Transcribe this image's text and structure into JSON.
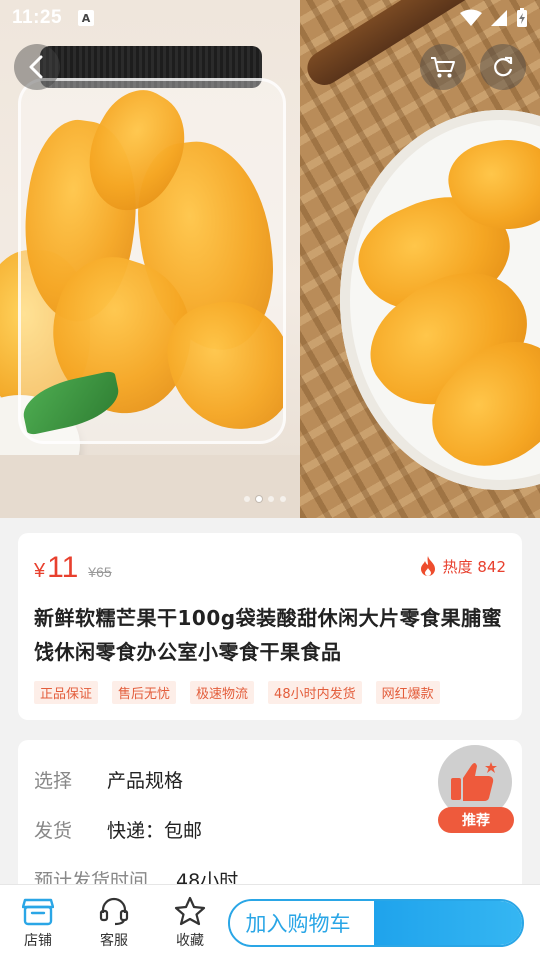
{
  "status_bar": {
    "time": "11:25"
  },
  "hero": {
    "carousel": {
      "count": 4,
      "active_index": 1
    }
  },
  "product": {
    "currency": "¥",
    "price": "11",
    "original_price": "¥65",
    "heat_label": "热度 842",
    "title": "新鲜软糯芒果干100g袋装酸甜休闲大片零食果脯蜜饯休闲零食办公室小零食干果食品",
    "tags": [
      "正品保证",
      "售后无忧",
      "极速物流",
      "48小时内发货",
      "网红爆款"
    ]
  },
  "spec": {
    "rows": [
      {
        "key": "选择",
        "value": "产品规格"
      },
      {
        "key": "发货",
        "value": "快递：包邮"
      },
      {
        "key": "预计发货时间",
        "value": "48小时"
      }
    ]
  },
  "recommend": {
    "label": "推荐"
  },
  "bottom_bar": {
    "items": [
      {
        "label": "店铺",
        "icon": "store-icon"
      },
      {
        "label": "客服",
        "icon": "headset-icon"
      },
      {
        "label": "收藏",
        "icon": "star-icon"
      }
    ],
    "add_to_cart": "加入购物车"
  },
  "colors": {
    "accent": "#2aa6e6",
    "price": "#e8402e",
    "tag_bg": "#fdeee8",
    "recommend": "#ee5a3c"
  }
}
